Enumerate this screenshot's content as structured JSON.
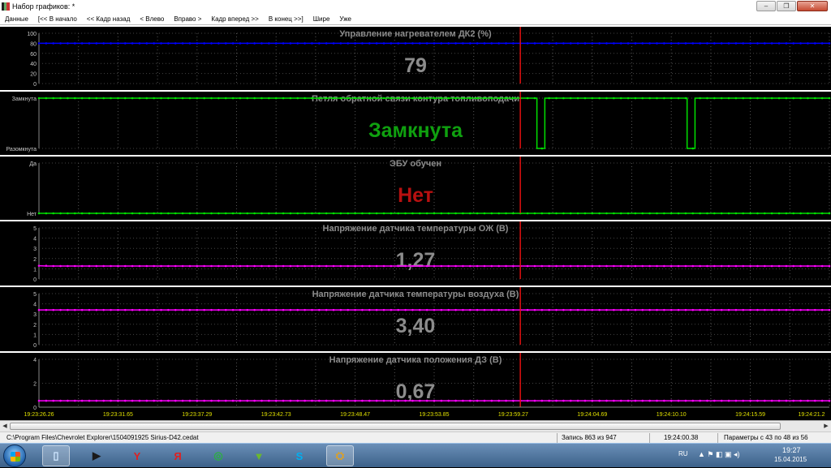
{
  "window": {
    "title": "Набор графиков: *"
  },
  "menu": [
    "Данные",
    "[<< В начало",
    "<< Кадр назад",
    "< Влево",
    "Вправо >",
    "Кадр вперед >>",
    "В конец >>]",
    "Шире",
    "Уже"
  ],
  "colors": {
    "blue_series": "#0000ff",
    "green_series": "#00e000",
    "magenta_series": "#ff00ff",
    "cursor": "#e01010",
    "title_gray": "#8c8c8c",
    "value_gray": "#8c8c8c",
    "value_green": "#0fa00f",
    "value_red": "#b81010"
  },
  "time_ticks": [
    "19:23:26.26",
    "19:23:31.65",
    "19:23:37.29",
    "19:23:42.73",
    "19:23:48.47",
    "19:23:53.85",
    "19:23:59.27",
    "19:24:04.69",
    "19:24:10.10",
    "19:24:15.59",
    "19:24:21.2"
  ],
  "chart_data": [
    {
      "type": "line",
      "title": "Управление нагревателем ДК2  (%)",
      "current_value": "79",
      "value_color": "value_gray",
      "series_color": "blue_series",
      "y_ticks": [
        "100",
        "80",
        "60",
        "40",
        "20",
        "0"
      ],
      "ylim": [
        0,
        100
      ],
      "x_range": [
        0,
        10
      ],
      "series": [
        {
          "x": [
            0,
            10
          ],
          "y": [
            80,
            80
          ]
        }
      ]
    },
    {
      "type": "line",
      "title": "Петля обратной связи контура топливоподачи",
      "current_value": "Замкнута",
      "value_color": "value_green",
      "series_color": "green_series",
      "y_ticks": [
        "Замкнута",
        "Разомкнута"
      ],
      "ylim": [
        0,
        1
      ],
      "x_range": [
        0,
        10
      ],
      "series": [
        {
          "x": [
            0,
            6.3,
            6.3,
            6.4,
            6.4,
            8.2,
            8.2,
            8.3,
            8.3,
            10
          ],
          "y": [
            1,
            1,
            0,
            0,
            1,
            1,
            0,
            0,
            1,
            1
          ]
        }
      ]
    },
    {
      "type": "line",
      "title": "ЭБУ обучен",
      "current_value": "Нет",
      "value_color": "value_red",
      "series_color": "green_series",
      "y_ticks": [
        "Да",
        "Нет"
      ],
      "ylim": [
        0,
        1
      ],
      "x_range": [
        0,
        10
      ],
      "series": [
        {
          "x": [
            0,
            10
          ],
          "y": [
            0,
            0
          ]
        }
      ]
    },
    {
      "type": "line",
      "title": "Напряжение датчика температуры ОЖ  (В)",
      "current_value": "1,27",
      "value_color": "value_gray",
      "series_color": "magenta_series",
      "y_ticks": [
        "5",
        "4",
        "3",
        "2",
        "1",
        "0"
      ],
      "ylim": [
        0,
        5
      ],
      "x_range": [
        0,
        10
      ],
      "series": [
        {
          "x": [
            0,
            0.1,
            10
          ],
          "y": [
            1.3,
            1.27,
            1.27
          ]
        }
      ]
    },
    {
      "type": "line",
      "title": "Напряжение датчика температуры воздуха  (В)",
      "current_value": "3,40",
      "value_color": "value_gray",
      "series_color": "magenta_series",
      "y_ticks": [
        "5",
        "4",
        "3",
        "2",
        "1",
        "0"
      ],
      "ylim": [
        0,
        5
      ],
      "x_range": [
        0,
        10
      ],
      "series": [
        {
          "x": [
            0,
            10
          ],
          "y": [
            3.4,
            3.4
          ]
        }
      ]
    },
    {
      "type": "line",
      "title": "Напряжение датчика положения ДЗ  (В)",
      "current_value": "0,67",
      "value_color": "value_gray",
      "series_color": "magenta_series",
      "y_ticks": [
        "4",
        "2",
        "0"
      ],
      "ylim": [
        0,
        5
      ],
      "x_range": [
        0,
        10
      ],
      "series": [
        {
          "x": [
            0,
            10
          ],
          "y": [
            0.67,
            0.67
          ]
        }
      ]
    }
  ],
  "cursor_position": 6.09,
  "status": {
    "path": "C:\\Program Files\\Chevrolet Explorer\\1504091925 Sirius-D42.cedat",
    "record": "Запись 863 из 947",
    "time": "19:24:00.38",
    "params": "Параметры с 43 по 48 из 56"
  },
  "taskbar": {
    "lang": "RU",
    "clock_time": "19:27",
    "clock_date": "15.04.2015",
    "apps": [
      {
        "icon": "files-icon",
        "glyph": "▯",
        "color": "#cfe6ff"
      },
      {
        "icon": "media-player-icon",
        "glyph": "▶",
        "color": "#1a1a1a"
      },
      {
        "icon": "yandex-browser-icon",
        "glyph": "Y",
        "color": "#e02020"
      },
      {
        "icon": "yandex-icon",
        "glyph": "Я",
        "color": "#e02020"
      },
      {
        "icon": "chat-icon",
        "glyph": "◎",
        "color": "#2bb040"
      },
      {
        "icon": "downloader-icon",
        "glyph": "▼",
        "color": "#6ab82e"
      },
      {
        "icon": "skype-icon",
        "glyph": "S",
        "color": "#00aff0"
      },
      {
        "icon": "car-diagnostic-icon",
        "glyph": "⛭",
        "color": "#e0a020"
      }
    ]
  }
}
